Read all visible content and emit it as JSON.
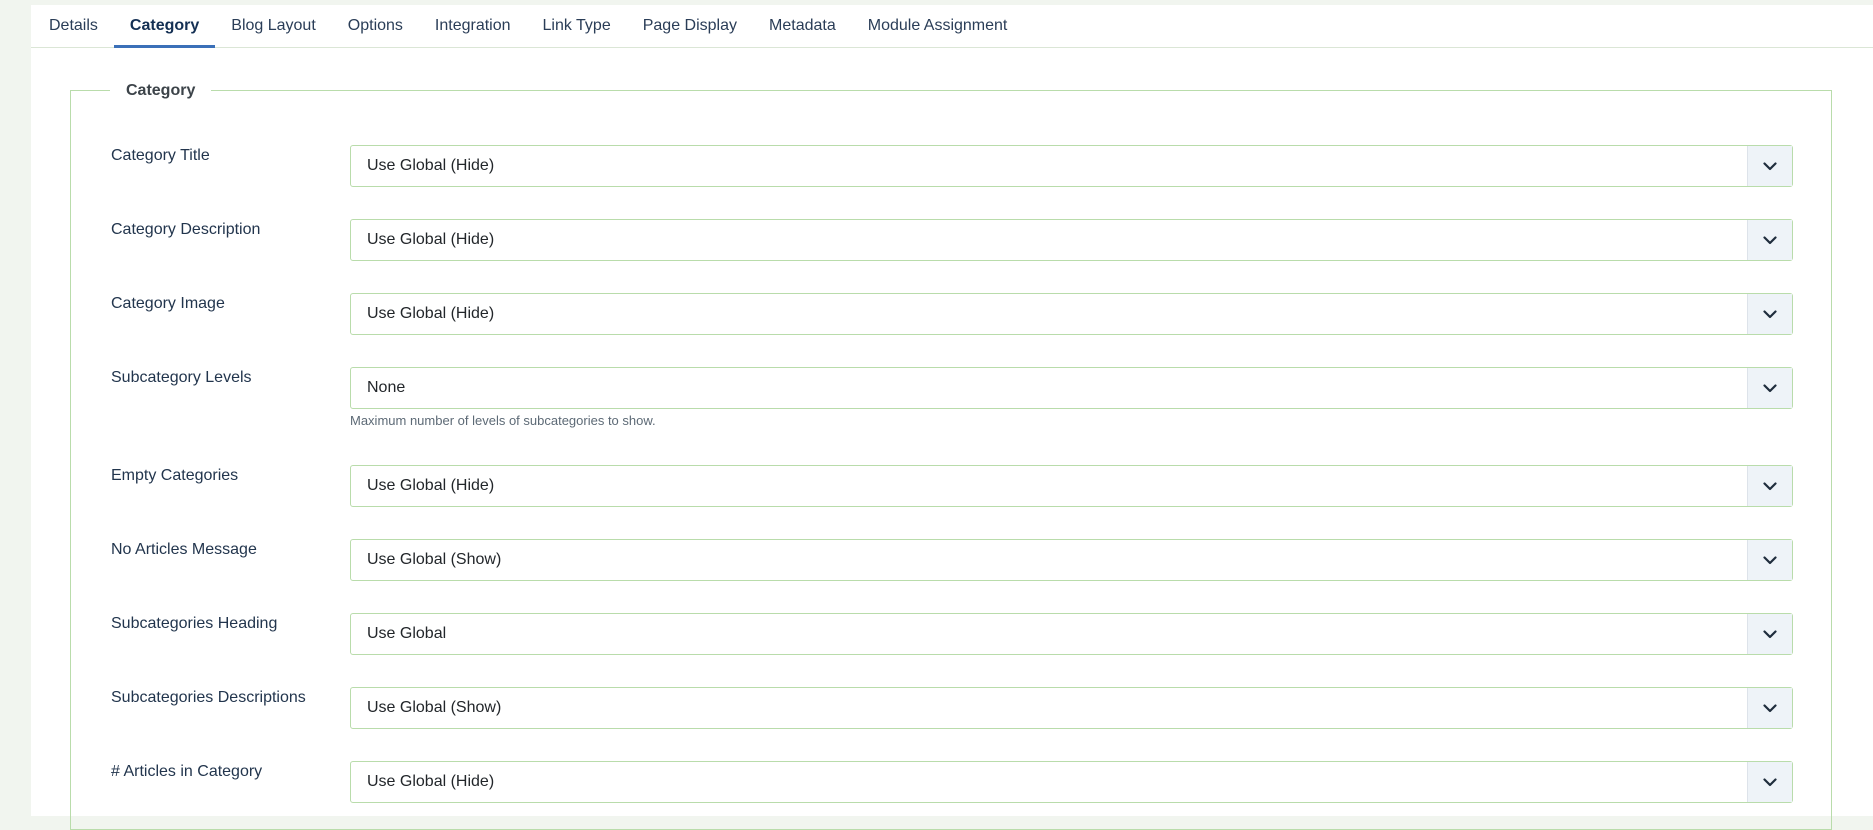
{
  "tabs": [
    {
      "label": "Details",
      "active": false
    },
    {
      "label": "Category",
      "active": true
    },
    {
      "label": "Blog Layout",
      "active": false
    },
    {
      "label": "Options",
      "active": false
    },
    {
      "label": "Integration",
      "active": false
    },
    {
      "label": "Link Type",
      "active": false
    },
    {
      "label": "Page Display",
      "active": false
    },
    {
      "label": "Metadata",
      "active": false
    },
    {
      "label": "Module Assignment",
      "active": false
    }
  ],
  "fieldset": {
    "legend": "Category",
    "fields": [
      {
        "label": "Category Title",
        "value": "Use Global (Hide)"
      },
      {
        "label": "Category Description",
        "value": "Use Global (Hide)"
      },
      {
        "label": "Category Image",
        "value": "Use Global (Hide)"
      },
      {
        "label": "Subcategory Levels",
        "value": "None",
        "help": "Maximum number of levels of subcategories to show."
      },
      {
        "label": "Empty Categories",
        "value": "Use Global (Hide)"
      },
      {
        "label": "No Articles Message",
        "value": "Use Global (Show)"
      },
      {
        "label": "Subcategories Heading",
        "value": "Use Global"
      },
      {
        "label": "Subcategories Descriptions",
        "value": "Use Global (Show)"
      },
      {
        "label": "# Articles in Category",
        "value": "Use Global (Hide)"
      }
    ]
  },
  "icons": {
    "select_caret": "chevron-down-icon"
  },
  "colors": {
    "page_background": "#f1f5ef",
    "border_green": "#b9dcab",
    "active_tab_underline": "#3b70b8",
    "caret_background": "#eef3f8"
  }
}
